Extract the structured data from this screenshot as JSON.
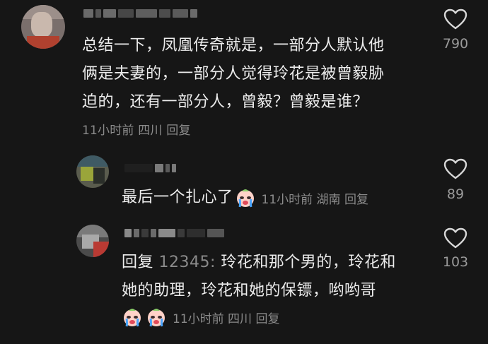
{
  "comments": [
    {
      "id": "c1",
      "text_lines": [
        "总结一下，凤凰传奇就是，一部分人默认他",
        "俩是夫妻的，一部分人觉得玲花是被曾毅胁",
        "迫的，还有一部分人，曾毅？曾毅是谁？"
      ],
      "meta": "11小时前 四川 回复",
      "likes": "790"
    },
    {
      "id": "c2",
      "text": "最后一个扎心了",
      "emoji": "crying-face-emoji",
      "meta": "11小时前 湖南 回复",
      "likes": "89"
    },
    {
      "id": "c3",
      "reply_prefix": "回复",
      "reply_target": "12345:",
      "text_line1": " 玲花和那个男的，玲花和",
      "text_line2": "她的助理，玲花和她的保镖，哟哟哥",
      "emojis": [
        "crying-face-emoji",
        "crying-face-emoji"
      ],
      "meta": "11小时前 四川 回复",
      "likes": "103"
    }
  ],
  "colors": {
    "background": "#161616",
    "text": "#ececec",
    "meta": "#8b8b8b"
  }
}
